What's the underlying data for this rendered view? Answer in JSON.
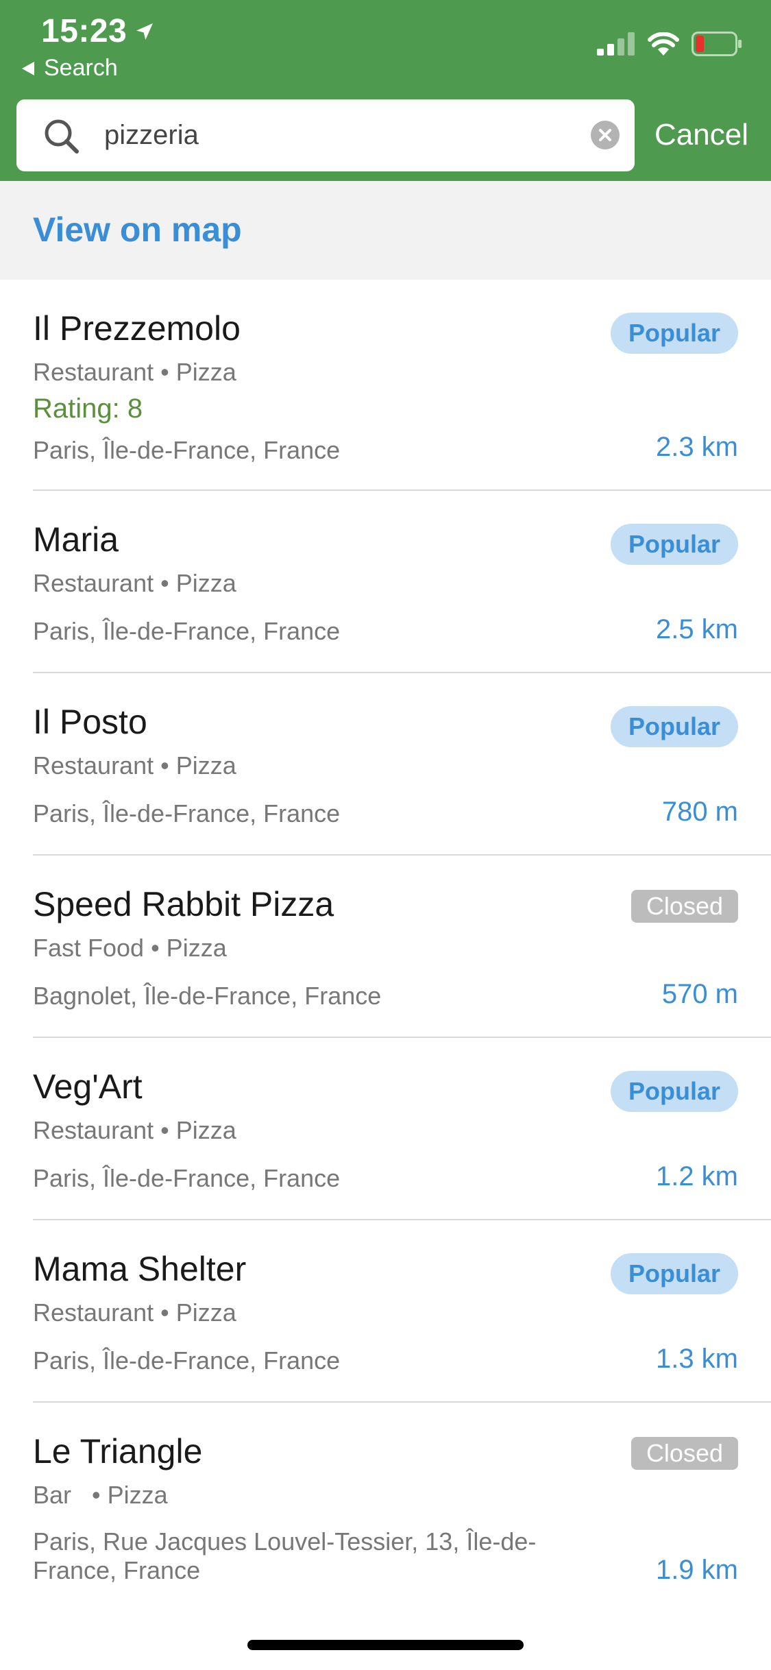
{
  "status_bar": {
    "time": "15:23",
    "back_label": "Search"
  },
  "search": {
    "value": "pizzeria",
    "placeholder": "",
    "cancel_label": "Cancel"
  },
  "view_on_map": "View on map",
  "results": [
    {
      "name": "Il Prezzemolo",
      "category": "Restaurant • Pizza",
      "rating": "Rating: 8",
      "location": "Paris, Île-de-France, France",
      "distance": "2.3 km",
      "badge": "Popular",
      "badge_type": "popular"
    },
    {
      "name": "Maria",
      "category": "Restaurant • Pizza",
      "rating": "",
      "location": "Paris, Île-de-France, France",
      "distance": "2.5 km",
      "badge": "Popular",
      "badge_type": "popular"
    },
    {
      "name": "Il Posto",
      "category": "Restaurant • Pizza",
      "rating": "",
      "location": "Paris, Île-de-France, France",
      "distance": "780 m",
      "badge": "Popular",
      "badge_type": "popular"
    },
    {
      "name": "Speed Rabbit Pizza",
      "category": "Fast Food • Pizza",
      "rating": "",
      "location": "Bagnolet, Île-de-France, France",
      "distance": "570 m",
      "badge": "Closed",
      "badge_type": "closed"
    },
    {
      "name": "Veg'Art",
      "category": "Restaurant • Pizza",
      "rating": "",
      "location": "Paris, Île-de-France, France",
      "distance": "1.2 km",
      "badge": "Popular",
      "badge_type": "popular"
    },
    {
      "name": "Mama Shelter",
      "category": "Restaurant • Pizza",
      "rating": "",
      "location": "Paris, Île-de-France, France",
      "distance": "1.3 km",
      "badge": "Popular",
      "badge_type": "popular"
    },
    {
      "name": "Le Triangle",
      "category": "Bar   • Pizza",
      "rating": "",
      "location": "Paris, Rue Jacques Louvel-Tessier, 13, Île-de-France, France",
      "distance": "1.9 km",
      "badge": "Closed",
      "badge_type": "closed"
    }
  ],
  "colors": {
    "header_green": "#4e9a4f",
    "link_blue": "#3a8ed6",
    "rating_green": "#5a8f3c",
    "popular_bg": "#c3def5",
    "closed_bg": "#bcbcbc"
  }
}
